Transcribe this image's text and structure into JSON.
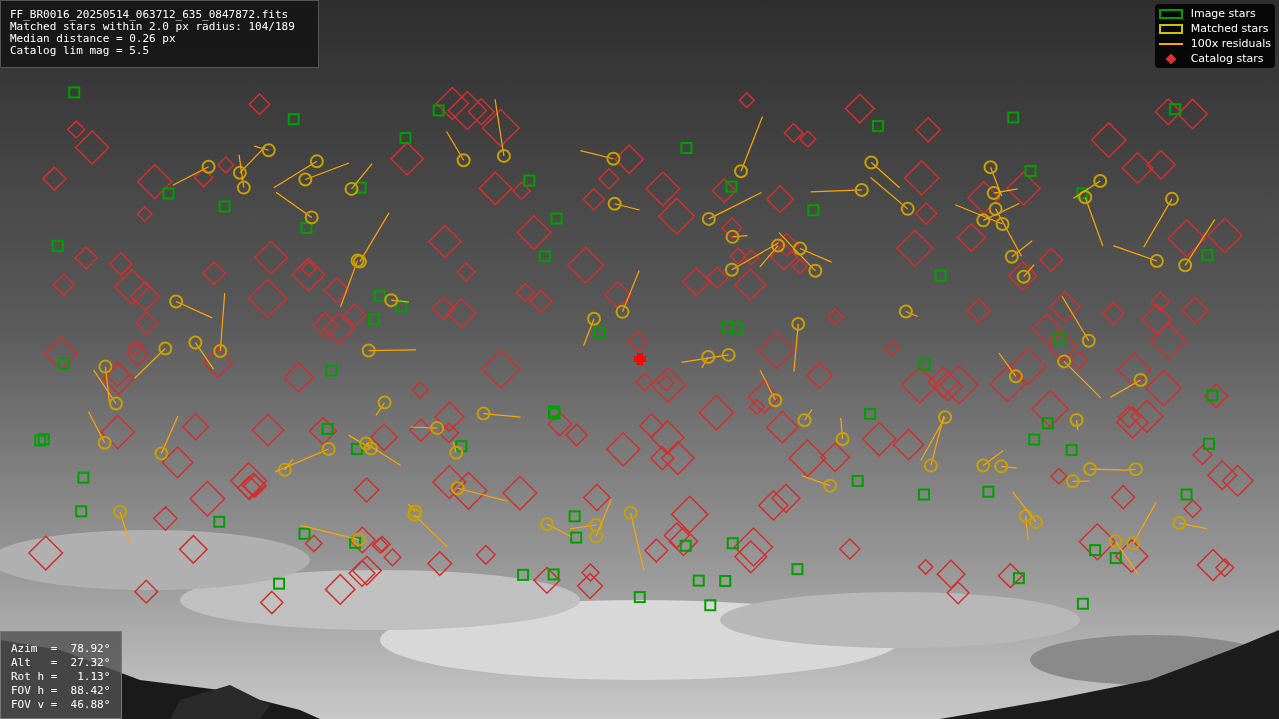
{
  "info_panel": {
    "lines": [
      "FF_BR0016_20250514_063712_635_0847872.fits",
      "Matched stars within 2.0 px radius: 104/189",
      "Median distance = 0.26 px",
      "Catalog lim mag = 5.5"
    ]
  },
  "legend": {
    "items": [
      {
        "kind": "box",
        "label": "Image stars",
        "color": "#00a000"
      },
      {
        "kind": "box",
        "label": "Matched stars",
        "color": "#c8c800"
      },
      {
        "kind": "line",
        "label": "100x residuals",
        "color": "#ffa500"
      },
      {
        "kind": "diamond",
        "label": "Catalog stars",
        "color": "#e03030"
      }
    ]
  },
  "pointing_panel": {
    "lines": [
      "Azim  =  78.92°",
      "Alt   =  27.32°",
      "Rot h =   1.13°",
      "FOV h =  88.42°",
      "FOV v =  46.88°"
    ]
  }
}
